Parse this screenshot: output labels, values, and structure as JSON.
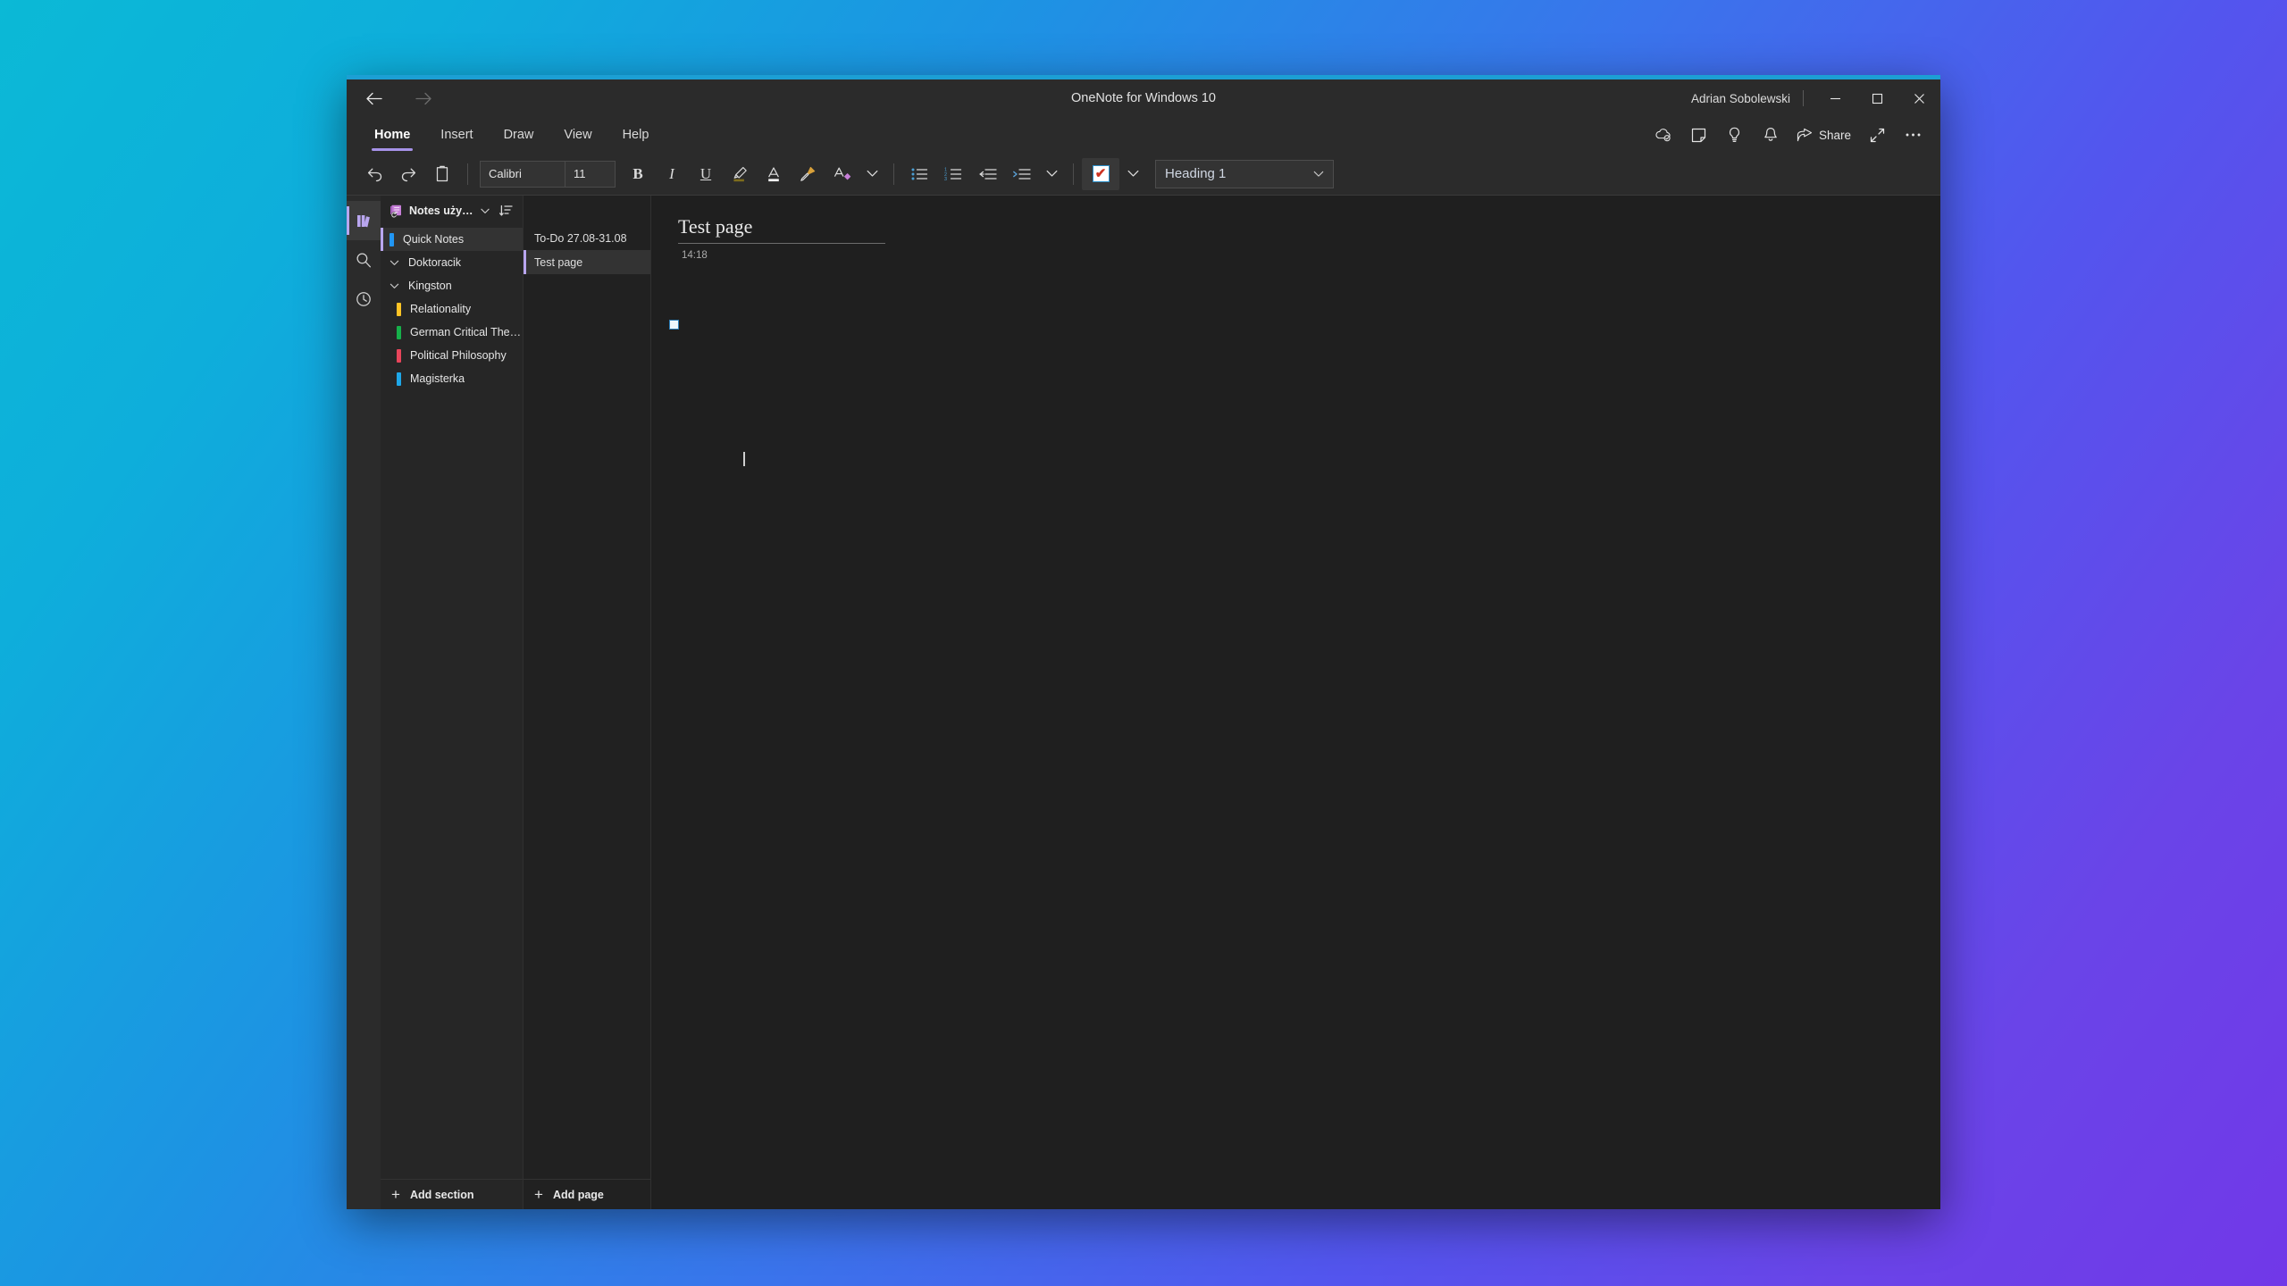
{
  "desktop": {
    "gradient_start": "#0bb9d6",
    "gradient_end": "#7138e8"
  },
  "window": {
    "accent_color": "#1c9fd4",
    "title": "OneNote for Windows 10",
    "account_name": "Adrian Sobolewski",
    "nav": {
      "back_label": "←",
      "forward_label": "→"
    },
    "controls": {
      "minimize": "─",
      "maximize": "☐",
      "close": "✕"
    }
  },
  "ribbon": {
    "tabs": [
      {
        "label": "Home",
        "active": true
      },
      {
        "label": "Insert",
        "active": false
      },
      {
        "label": "Draw",
        "active": false
      },
      {
        "label": "View",
        "active": false
      },
      {
        "label": "Help",
        "active": false
      }
    ],
    "right_tools": [
      {
        "name": "sync-cloud-icon",
        "label": ""
      },
      {
        "name": "sticky-note-icon",
        "label": ""
      },
      {
        "name": "lightbulb-icon",
        "label": ""
      },
      {
        "name": "bell-icon",
        "label": ""
      },
      {
        "name": "share-icon",
        "label": "Share"
      },
      {
        "name": "expand-arrows-icon",
        "label": ""
      },
      {
        "name": "more-options-icon",
        "label": "…"
      }
    ]
  },
  "toolbar": {
    "undo_label": "undo-icon",
    "redo_label": "redo-icon",
    "clipboard_label": "clipboard-icon",
    "font_name": "Calibri",
    "font_size": "11",
    "bold_label": "B",
    "italic_label": "I",
    "underline_label": "U",
    "highlight_label": "highlight-icon",
    "font_color_label": "A",
    "format_painter_label": "format-painter-icon",
    "clear_formatting_label": "A",
    "more_font_caret": "⌄",
    "bullets_label": "bullet-list-icon",
    "numbering_label": "numbered-list-icon",
    "decrease_indent_label": "decrease-indent-icon",
    "increase_indent_label": "increase-indent-icon",
    "list_caret": "⌄",
    "todo_tag_mark": "✔",
    "todo_caret": "⌄",
    "style_value": "Heading 1",
    "style_caret": "⌄"
  },
  "rail": {
    "items": [
      {
        "name": "navigation-notebooks-icon",
        "active": true
      },
      {
        "name": "search-icon",
        "active": false
      },
      {
        "name": "recent-notes-clock-icon",
        "active": false
      }
    ]
  },
  "notebook": {
    "name": "Notes użytkownika Adrian",
    "caret": "⌄",
    "sort_icon": "sort-icon",
    "sections": [
      {
        "label": "Quick Notes",
        "color": "#2196f3",
        "type": "section",
        "selected": true,
        "indent": false,
        "chevron": ""
      },
      {
        "label": "Doktoracik",
        "color": "",
        "type": "group",
        "selected": false,
        "indent": false,
        "chevron": "⌄"
      },
      {
        "label": "Kingston",
        "color": "",
        "type": "group",
        "selected": false,
        "indent": false,
        "chevron": "⌄"
      },
      {
        "label": "Relationality",
        "color": "#ffc425",
        "type": "section",
        "selected": false,
        "indent": true,
        "chevron": ""
      },
      {
        "label": "German Critical Theory",
        "color": "#16b04a",
        "type": "section",
        "selected": false,
        "indent": true,
        "chevron": ""
      },
      {
        "label": "Political Philosophy",
        "color": "#e8455b",
        "type": "section",
        "selected": false,
        "indent": true,
        "chevron": ""
      },
      {
        "label": "Magisterka",
        "color": "#1ea7e8",
        "type": "section",
        "selected": false,
        "indent": true,
        "chevron": ""
      }
    ],
    "add_section_label": "Add section",
    "add_section_plus": "+"
  },
  "pages": {
    "items": [
      {
        "label": "To-Do 27.08-31.08",
        "selected": false
      },
      {
        "label": "Test page",
        "selected": true
      }
    ],
    "add_page_label": "Add page",
    "add_page_plus": "+"
  },
  "canvas": {
    "page_title": "Test page",
    "page_time": "14:18",
    "todo_checkbox_checked": false
  }
}
